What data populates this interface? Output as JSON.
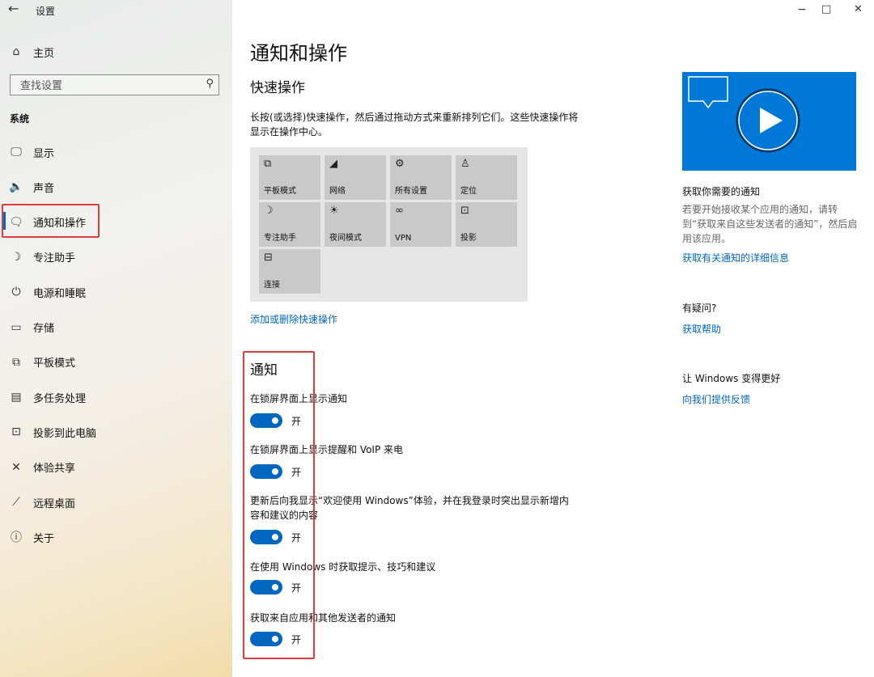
{
  "window": {
    "title": "设置",
    "back_icon": "←",
    "controls": {
      "minimize": "−",
      "maximize": "□",
      "close": "✕"
    }
  },
  "sidebar": {
    "home": {
      "label": "主页",
      "icon": "home-icon"
    },
    "search_placeholder": "查找设置",
    "section": "系统",
    "items": [
      {
        "label": "显示",
        "icon": "monitor-icon",
        "glyph": "🖵"
      },
      {
        "label": "声音",
        "icon": "speaker-icon",
        "glyph": "🔈"
      },
      {
        "label": "通知和操作",
        "icon": "notification-icon",
        "glyph": "🗨",
        "active": true
      },
      {
        "label": "专注助手",
        "icon": "moon-icon",
        "glyph": "☽"
      },
      {
        "label": "电源和睡眠",
        "icon": "power-icon",
        "glyph": "⏻"
      },
      {
        "label": "存储",
        "icon": "storage-icon",
        "glyph": "▭"
      },
      {
        "label": "平板模式",
        "icon": "tablet-mode-icon",
        "glyph": "⧉"
      },
      {
        "label": "多任务处理",
        "icon": "multitask-icon",
        "glyph": "▤"
      },
      {
        "label": "投影到此电脑",
        "icon": "project-icon",
        "glyph": "⊡"
      },
      {
        "label": "体验共享",
        "icon": "share-icon",
        "glyph": "✕"
      },
      {
        "label": "远程桌面",
        "icon": "remote-desktop-icon",
        "glyph": "⟋"
      },
      {
        "label": "关于",
        "icon": "info-icon",
        "glyph": "ⓘ"
      }
    ]
  },
  "main": {
    "title": "通知和操作",
    "quick_actions": {
      "heading": "快速操作",
      "description": "长按(或选择)快速操作，然后通过拖动方式来重新排列它们。这些快速操作将显示在操作中心。",
      "tiles": [
        {
          "label": "平板模式",
          "icon": "tablet-mode-icon",
          "glyph": "⧉"
        },
        {
          "label": "网络",
          "icon": "network-icon",
          "glyph": "◢"
        },
        {
          "label": "所有设置",
          "icon": "gear-icon",
          "glyph": "⚙"
        },
        {
          "label": "定位",
          "icon": "location-icon",
          "glyph": "♙"
        },
        {
          "label": "专注助手",
          "icon": "moon-icon",
          "glyph": "☽"
        },
        {
          "label": "夜间模式",
          "icon": "sun-icon",
          "glyph": "☀"
        },
        {
          "label": "VPN",
          "icon": "vpn-icon",
          "glyph": "∞"
        },
        {
          "label": "投影",
          "icon": "project-icon",
          "glyph": "⊡"
        },
        {
          "label": "连接",
          "icon": "connect-icon",
          "glyph": "⊟"
        }
      ],
      "edit_link": "添加或删除快速操作"
    },
    "notifications": {
      "heading": "通知",
      "settings": [
        {
          "label": "在锁屏界面上显示通知",
          "state": "开"
        },
        {
          "label": "在锁屏界面上显示提醒和 VoIP 来电",
          "state": "开"
        },
        {
          "label": "更新后向我显示“欢迎使用 Windows”体验，并在我登录时突出显示新增内容和建议的内容",
          "state": "开"
        },
        {
          "label": "在使用 Windows 时获取提示、技巧和建议",
          "state": "开"
        },
        {
          "label": "获取来自应用和其他发送者的通知",
          "state": "开"
        }
      ]
    }
  },
  "right_panel": {
    "video_icon": "play-icon",
    "get_notifications": {
      "title": "获取你需要的通知",
      "text": "若要开始接收某个应用的通知，请转到“获取来自这些发送者的通知”，然后启用该应用。",
      "link": "获取有关通知的详细信息"
    },
    "help": {
      "title": "有疑问?",
      "link": "获取帮助"
    },
    "feedback": {
      "title": "让 Windows 变得更好",
      "link": "向我们提供反馈"
    }
  },
  "colors": {
    "accent": "#0067c0",
    "highlight_red": "#e03c3c",
    "video_bg": "#0078d7"
  }
}
